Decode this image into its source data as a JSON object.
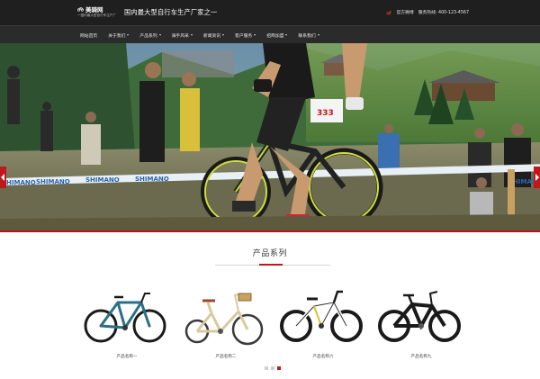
{
  "header": {
    "brand_name": "美骑网",
    "brand_sub": "一国内最大型自行车生产厂",
    "slogan": "国内最大型自行车生产厂家之一",
    "weibo_label": "官方微博",
    "hotline_label": "服务热线: 400-123-4567"
  },
  "nav": {
    "items": [
      {
        "label": "网站首页",
        "caret": false
      },
      {
        "label": "关于我们",
        "caret": true
      },
      {
        "label": "产品系列",
        "caret": true
      },
      {
        "label": "骑手风采",
        "caret": true
      },
      {
        "label": "新闻资讯",
        "caret": true
      },
      {
        "label": "客户服务",
        "caret": true
      },
      {
        "label": "招商加盟",
        "caret": true
      },
      {
        "label": "联系我们",
        "caret": true
      }
    ]
  },
  "hero": {
    "banner_text": "SHIMANO",
    "race_number": "333"
  },
  "products": {
    "title": "产品系列",
    "items": [
      {
        "name": "产品名称一",
        "frame_color": "#2b6f86"
      },
      {
        "name": "产品名称二",
        "frame_color": "#d9c9a0"
      },
      {
        "name": "产品名称六",
        "frame_color": "#ffffff"
      },
      {
        "name": "产品名称九",
        "frame_color": "#1a1a1a"
      }
    ],
    "pager": {
      "count": 3,
      "active_index": 2
    }
  },
  "colors": {
    "accent": "#c0161c",
    "header_bg": "#1f1f1f",
    "nav_bg": "#2b2b2b"
  }
}
